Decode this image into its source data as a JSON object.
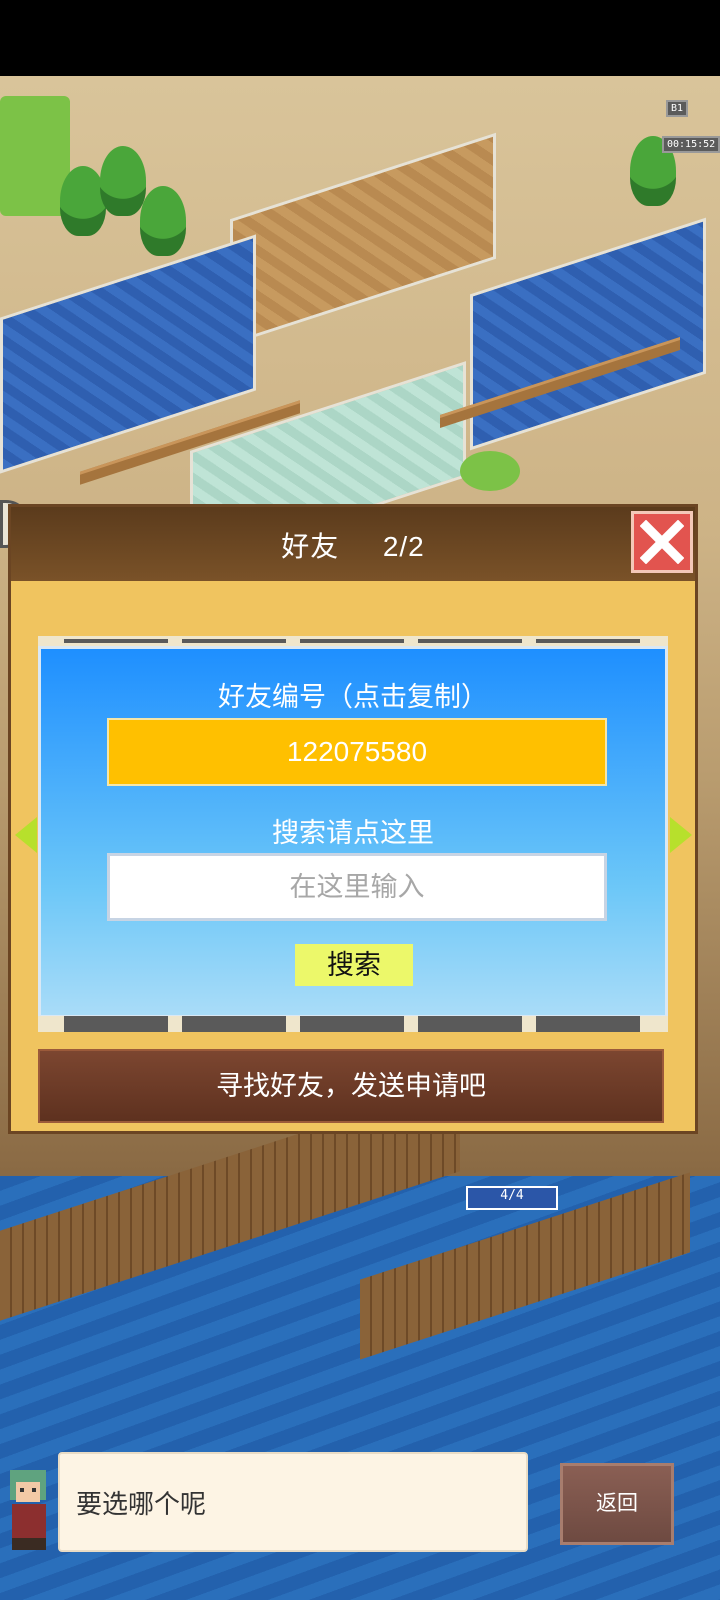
{
  "dialog": {
    "title": "好友",
    "count": "2/2"
  },
  "friend_panel": {
    "id_label": "好友编号（点击复制）",
    "friend_id": "122075580",
    "search_label": "搜索请点这里",
    "search_placeholder": "在这里输入",
    "search_button": "搜索"
  },
  "find_banner": "寻找好友，发送申请吧",
  "speech_text": "要选哪个呢",
  "back_button": "返回",
  "game_hud": {
    "floor_badge": "B1",
    "timer": "00:15:52",
    "room_capacity": "4/4"
  },
  "colors": {
    "dialog_bg": "#f0c45f",
    "header_bg": "#5b3b1c",
    "panel_blue": "#1e8fff",
    "friend_id_bg": "#ffc000",
    "search_button_bg": "#ecf86a",
    "close_button": "#e2544f",
    "banner_bg": "#6e3b27"
  }
}
